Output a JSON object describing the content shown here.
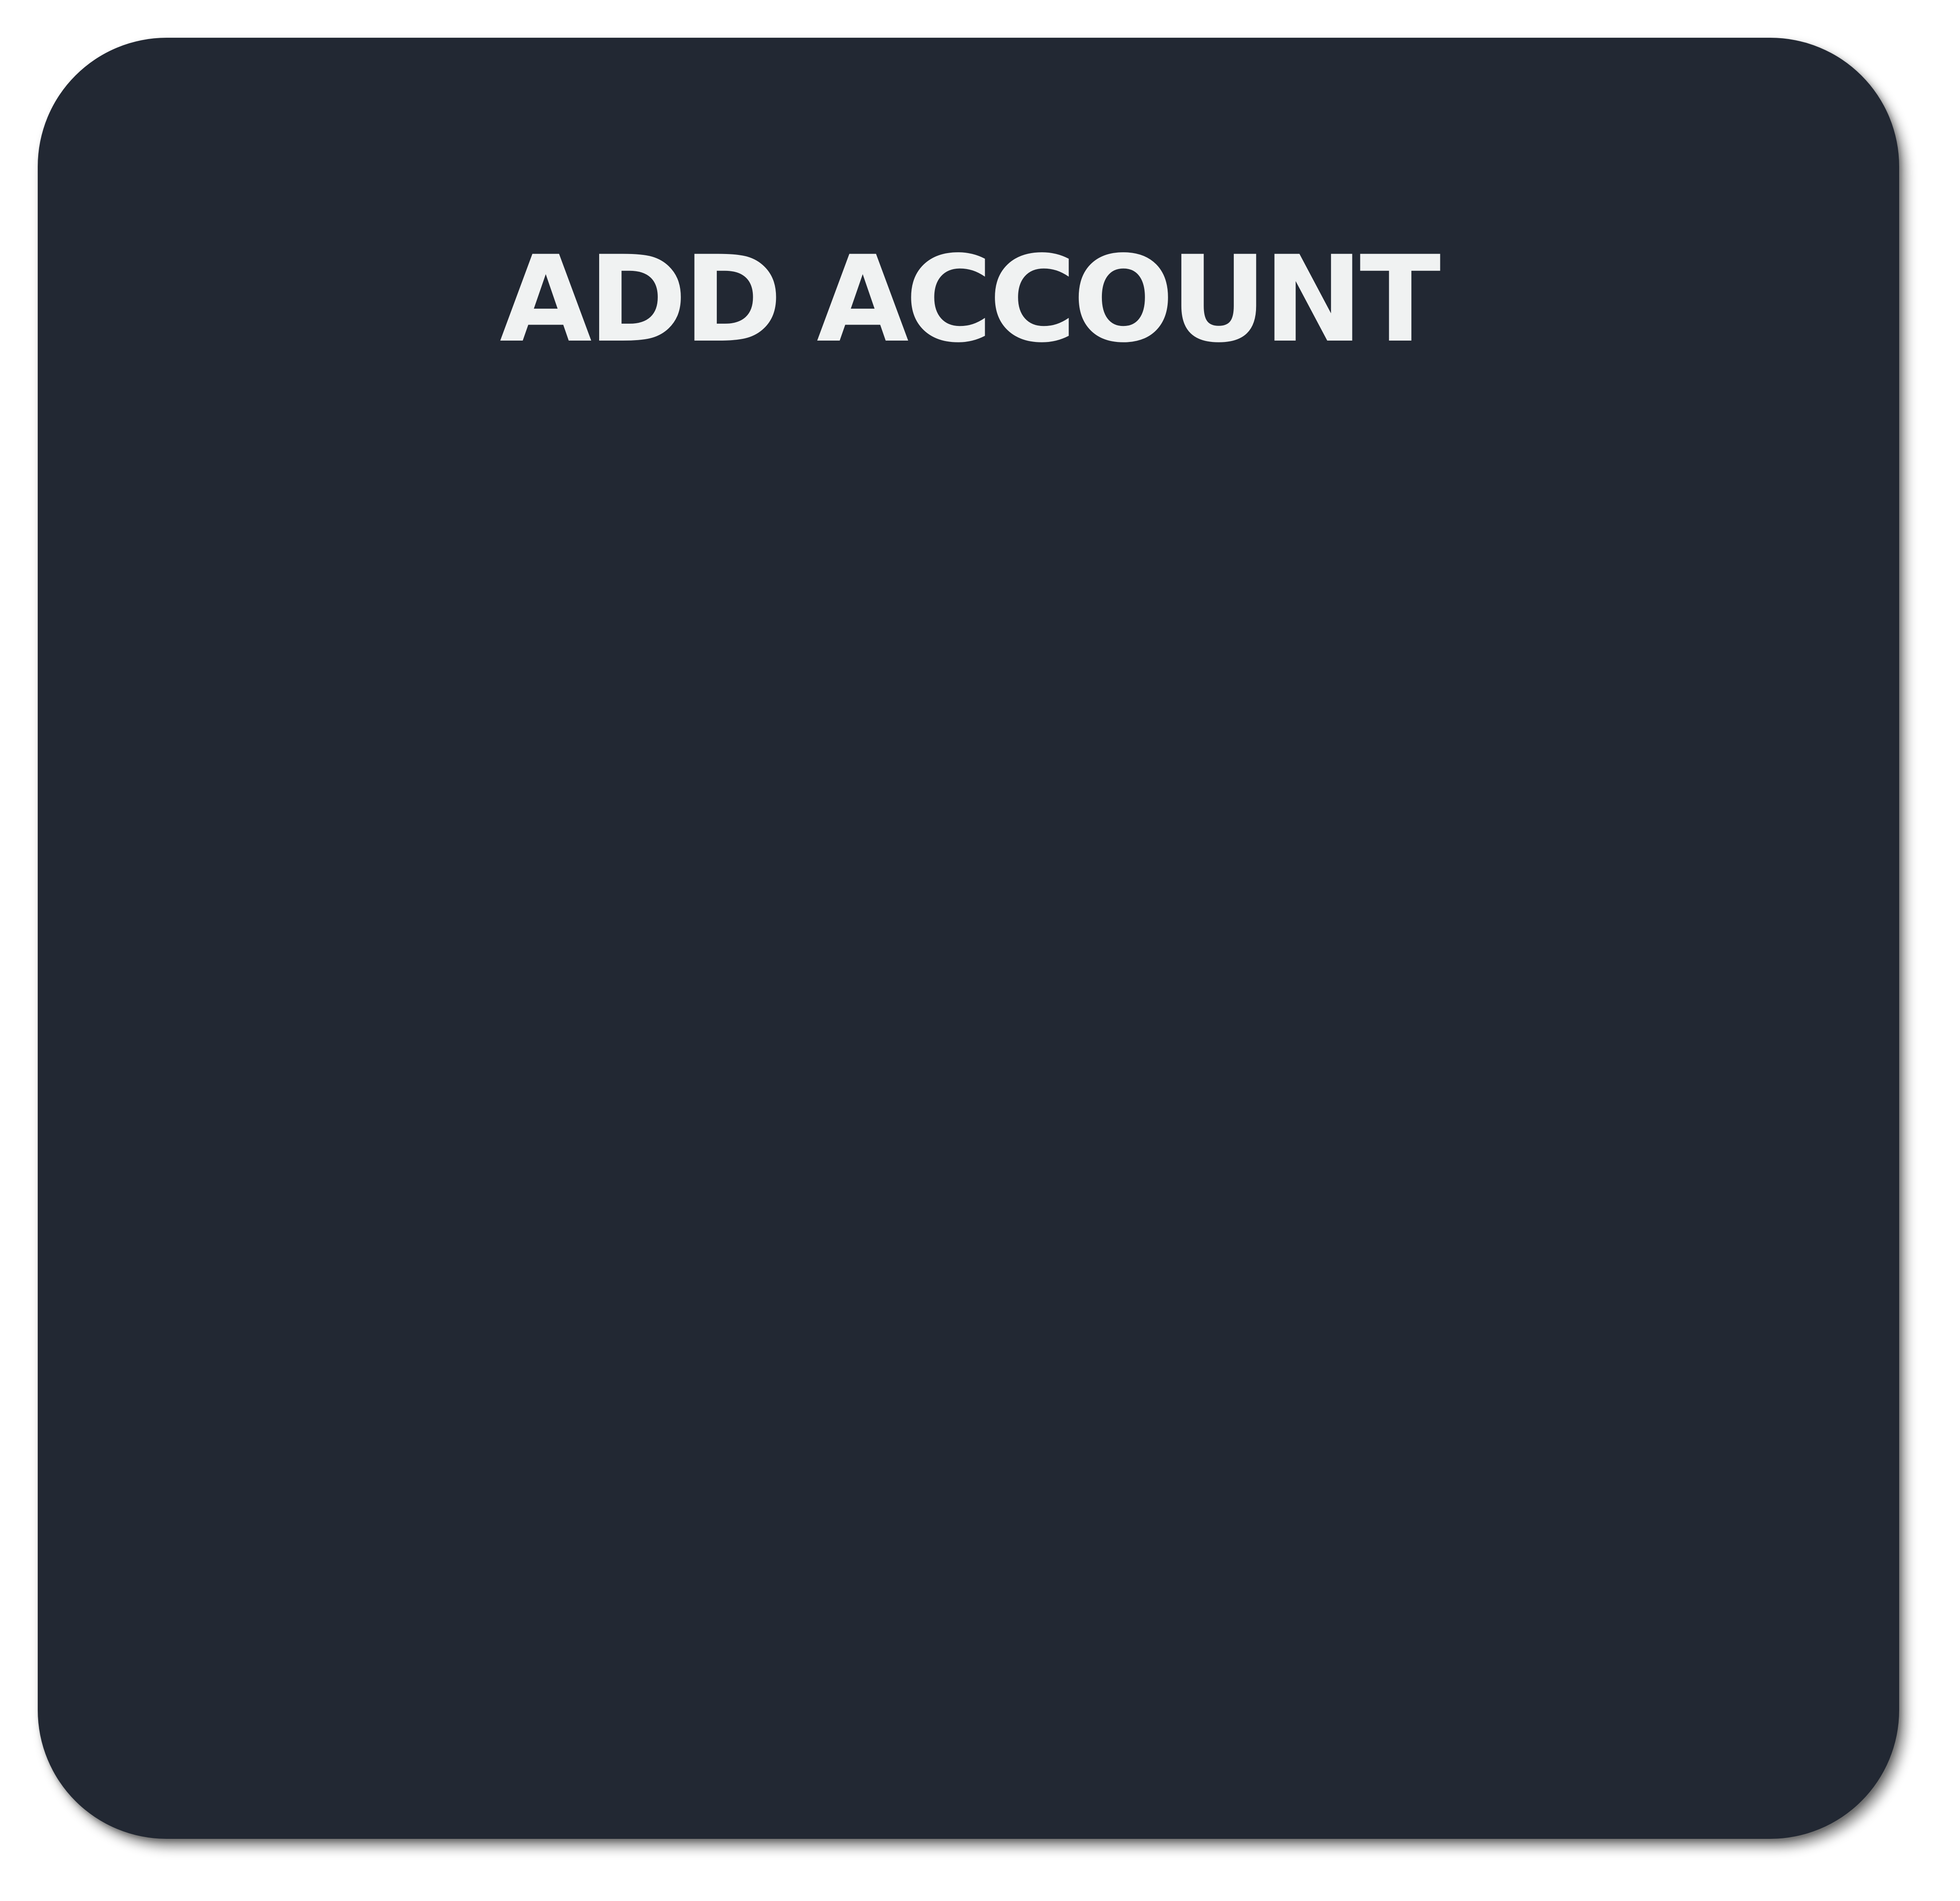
{
  "dialog": {
    "title": "ADD ACCOUNT",
    "background_color": "#222833",
    "title_color": "#f0f2f2"
  }
}
